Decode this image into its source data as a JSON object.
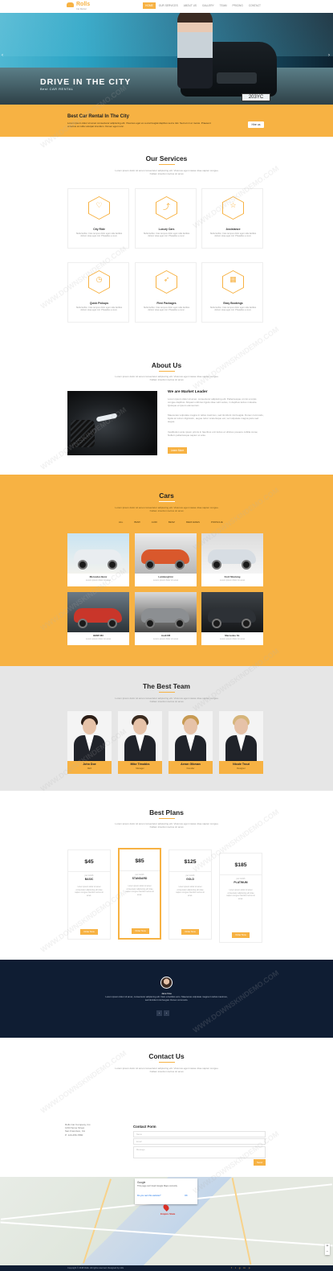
{
  "brand": {
    "name": "Rolls",
    "tagline": "Car Rental"
  },
  "nav": [
    {
      "label": "Home",
      "active": true
    },
    {
      "label": "Our services"
    },
    {
      "label": "About us"
    },
    {
      "label": "Gallery"
    },
    {
      "label": "Team"
    },
    {
      "label": "Pricing"
    },
    {
      "label": "Contact"
    }
  ],
  "hero": {
    "title": "DRIVE IN THE CITY",
    "subtitle": "Best CAR RENTAL",
    "plate": "203YC",
    "prev": "‹",
    "next": "›"
  },
  "banner": {
    "title": "Best Car Rental In The City",
    "text": "Lorem ipsum dolor sit amet consectetur adipiscing elit. Vivamus eget ex a erat feugiat dapibus sed a nisl. Sed et mi et metus. Praesent ut lectus at nulla volutpat interdum. Donec eget nunc.",
    "button": "Hire us"
  },
  "services": {
    "title": "Our Services",
    "desc": "Lorem ipsum dolor sit amet consectetur adipiscing elit. Vivamus eget massa vitae sapien congue. Nullam interdum lectus sit amet.",
    "items": [
      {
        "icon": "heart-icon",
        "glyph": "♡",
        "name": "City Ride",
        "text": "Nulla facilisi. Cras tempus dolor eget nulla facilisis dictum vitae eget nisl. Phasellus a nunc."
      },
      {
        "icon": "chart-icon",
        "glyph": "⤴",
        "name": "Luxury Cars",
        "text": "Nulla facilisi. Cras tempus dolor eget nulla facilisis dictum vitae eget nisl. Phasellus a nunc."
      },
      {
        "icon": "star-icon",
        "glyph": "☆",
        "name": "Assistance",
        "text": "Nulla facilisi. Cras tempus dolor eget nulla facilisis dictum vitae eget nisl. Phasellus a nunc."
      },
      {
        "icon": "clock-icon",
        "glyph": "◷",
        "name": "Quick Pickups",
        "text": "Nulla facilisi. Cras tempus dolor eget nulla facilisis dictum vitae eget nisl. Phasellus a nunc."
      },
      {
        "icon": "send-icon",
        "glyph": "➶",
        "name": "Flexi Packages",
        "text": "Nulla facilisi. Cras tempus dolor eget nulla facilisis dictum vitae eget nisl. Phasellus a nunc."
      },
      {
        "icon": "calendar-icon",
        "glyph": "▦",
        "name": "Easy Bookings",
        "text": "Nulla facilisi. Cras tempus dolor eget nulla facilisis dictum vitae eget nisl. Phasellus a nunc."
      }
    ]
  },
  "about": {
    "title": "About Us",
    "desc": "Lorem ipsum dolor sit amet consectetur adipiscing elit. Vivamus eget massa vitae sapien congue. Nullam interdum lectus sit amet.",
    "heading": "We are Market Leader",
    "p1": "Lorem ipsum dolor sit amet, consectetur adipiscing elit. Pellentesque ut nisi a turpis congue dapibus. Aliquam ultricies ligula vitae velit varius, in dapibus lectus molestie. Quisque et ipsum elementum.",
    "p2": "Maecenas vulputate magna in tellus maximus, sed tincidunt nisi feugiat. Donec commodo, ligula at rutrum dignissim, augue tortor scelerisque est, vel vulputate magna justo sed augue.",
    "p3": "Vestibulum ante ipsum primis in faucibus orci luctus et ultrices posuere cubilia curae; Nullam pellentesque sapien et ante.",
    "button": "Learn More"
  },
  "cars": {
    "title": "Cars",
    "desc": "Lorem ipsum dolor sit amet consectetur adipiscing elit. Vivamus eget massa vitae sapien congue. Nullam interdum lectus sit amet.",
    "filters": [
      "All",
      "BMW",
      "Audi",
      "Benz",
      "Mercedes",
      "Porsche"
    ],
    "items": [
      {
        "name": "Mercedes Benz",
        "sub": "Lorem ipsum dolor sit amet",
        "color": "#e9edf0"
      },
      {
        "name": "Lamborghini",
        "sub": "Lorem ipsum dolor sit amet",
        "color": "#d9582c"
      },
      {
        "name": "Ford Mustang",
        "sub": "Lorem ipsum dolor sit amet",
        "color": "#d7dde3"
      },
      {
        "name": "BMW M3",
        "sub": "Lorem ipsum dolor sit amet",
        "color": "#c9362a"
      },
      {
        "name": "Audi R8",
        "sub": "Lorem ipsum dolor sit amet",
        "color": "#8c8f92"
      },
      {
        "name": "Mercedes SL",
        "sub": "Lorem ipsum dolor sit amet",
        "color": "#2d3136"
      }
    ]
  },
  "team": {
    "title": "The Best Team",
    "desc": "Lorem ipsum dolor sit amet consectetur adipiscing elit. Vivamus eget massa vitae sapien congue. Nullam interdum lectus sit amet.",
    "members": [
      {
        "name": "John Doe",
        "role": "CEO",
        "hair": "#2b1d16"
      },
      {
        "name": "Mike Timobbs",
        "role": "Manager",
        "hair": "#3a2a1f"
      },
      {
        "name": "Aeron Gibman",
        "role": "Founder",
        "hair": "#c79a52"
      },
      {
        "name": "Nicole Trout",
        "role": "Designer",
        "hair": "#d6b57a"
      }
    ]
  },
  "plans": {
    "title": "Best Plans",
    "desc": "Lorem ipsum dolor sit amet consectetur adipiscing elit. Vivamus eget massa vitae sapien congue. Nullam interdum lectus sit amet.",
    "items": [
      {
        "price": "$45",
        "per": "per month",
        "name": "BASIC",
        "features": "Lorem ipsum dolor sit amet consectetur adipiscing elit vitae sapien congue interdum lectus sit amet.",
        "button": "Order Now"
      },
      {
        "price": "$85",
        "per": "per month",
        "name": "STANDARD",
        "features": "Lorem ipsum dolor sit amet consectetur adipiscing elit vitae sapien congue interdum lectus sit amet.",
        "button": "Order Now"
      },
      {
        "price": "$125",
        "per": "per month",
        "name": "GOLD",
        "features": "Lorem ipsum dolor sit amet consectetur adipiscing elit vitae sapien congue interdum lectus sit amet.",
        "button": "Order Now"
      },
      {
        "price": "$185",
        "per": "per month",
        "name": "PLATINUM",
        "features": "Lorem ipsum dolor sit amet consectetur adipiscing elit vitae sapien congue interdum lectus sit amet.",
        "button": "Order Now"
      }
    ]
  },
  "testimonial": {
    "name": "Jane Doe",
    "text": "Lorem ipsum dolor sit amet, consectetur adipiscing elit. Nam a facilisis arcu. Maecenas vulputate magna in tellus maximus, sed tincidunt nisi feugiat. Donec commodo.",
    "prev": "‹",
    "next": "›"
  },
  "contact": {
    "title": "Contact Us",
    "desc": "Lorem ipsum dolor sit amet consectetur adipiscing elit. Vivamus eget massa vitae sapien congue. Nullam interdum lectus sit amet.",
    "company": "Rolls Car Company, Inc.",
    "address1": "1234 Some Street",
    "address2": "San Francisco, CA",
    "phone": "P: 123-456-7890",
    "form_title": "Contact Form",
    "name_placeholder": "Name",
    "email_placeholder": "Email",
    "message_placeholder": "Message",
    "send": "Send"
  },
  "map": {
    "card_title": "Google",
    "card_sub": "This page can't load Google Maps correctly.",
    "card_link": "Do you own this website?",
    "card_ok": "OK",
    "pin_label": "Empire State",
    "zoom_in": "+",
    "zoom_out": "−"
  },
  "footer": {
    "copyright": "Copyright © 2018 Rolls. All rights reserved. Designed by rolls",
    "social": [
      "f",
      "t",
      "g",
      "in",
      "p"
    ]
  },
  "watermark": "WWW.DOWNSKINDEMO.COM",
  "colors": {
    "accent": "#f7b243",
    "dark": "#0f1d33",
    "gray_bg": "#e6e6e6"
  }
}
